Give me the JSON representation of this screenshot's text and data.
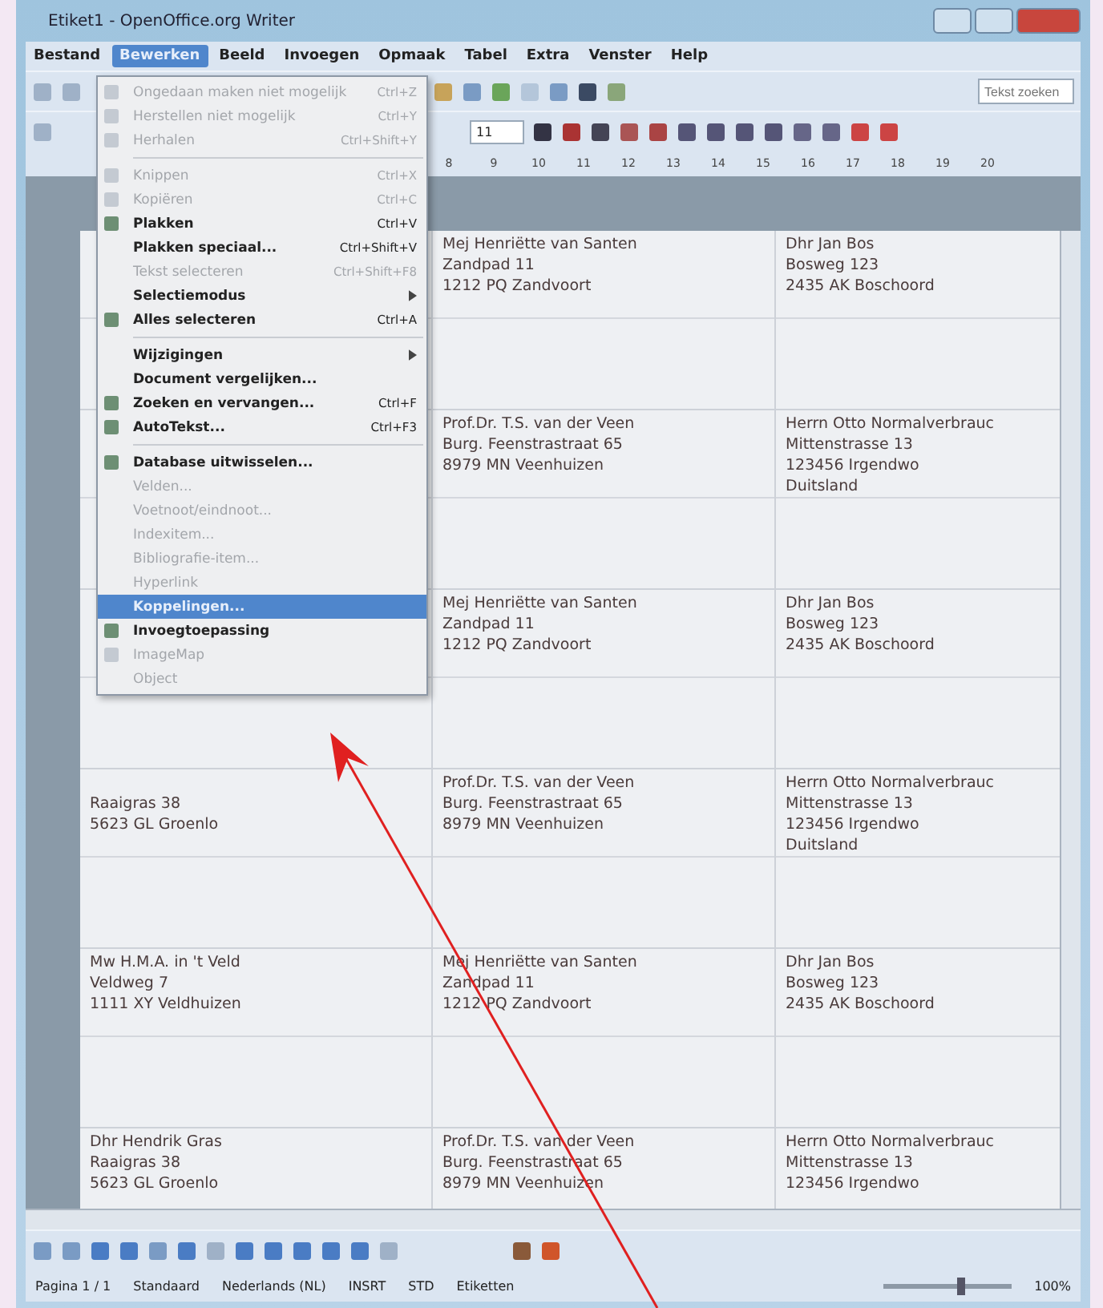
{
  "window": {
    "title": "Etiket1 - OpenOffice.org Writer"
  },
  "menubar": [
    {
      "label": "Bestand",
      "selected": false
    },
    {
      "label": "Bewerken",
      "selected": true
    },
    {
      "label": "Beeld",
      "selected": false
    },
    {
      "label": "Invoegen",
      "selected": false
    },
    {
      "label": "Opmaak",
      "selected": false
    },
    {
      "label": "Tabel",
      "selected": false
    },
    {
      "label": "Extra",
      "selected": false
    },
    {
      "label": "Venster",
      "selected": false
    },
    {
      "label": "Help",
      "selected": false
    }
  ],
  "toolbar": {
    "search": {
      "placeholder": "Tekst zoeken"
    },
    "font_size": "11"
  },
  "ruler": {
    "ticks": [
      "8",
      "9",
      "10",
      "11",
      "12",
      "13",
      "14",
      "15",
      "16",
      "17",
      "18",
      "19",
      "20"
    ]
  },
  "edit_menu": {
    "items": [
      {
        "kind": "item",
        "label": "Ongedaan maken niet mogelijk",
        "shortcut": "Ctrl+Z",
        "disabled": true,
        "selected": false,
        "submenu": false,
        "icon": true
      },
      {
        "kind": "item",
        "label": "Herstellen niet mogelijk",
        "shortcut": "Ctrl+Y",
        "disabled": true,
        "selected": false,
        "submenu": false,
        "icon": true
      },
      {
        "kind": "item",
        "label": "Herhalen",
        "shortcut": "Ctrl+Shift+Y",
        "disabled": true,
        "selected": false,
        "submenu": false,
        "icon": true
      },
      {
        "kind": "separator"
      },
      {
        "kind": "item",
        "label": "Knippen",
        "shortcut": "Ctrl+X",
        "disabled": true,
        "selected": false,
        "submenu": false,
        "icon": true
      },
      {
        "kind": "item",
        "label": "Kopiëren",
        "shortcut": "Ctrl+C",
        "disabled": true,
        "selected": false,
        "submenu": false,
        "icon": true
      },
      {
        "kind": "item",
        "label": "Plakken",
        "shortcut": "Ctrl+V",
        "disabled": false,
        "selected": false,
        "submenu": false,
        "icon": true
      },
      {
        "kind": "item",
        "label": "Plakken speciaal...",
        "shortcut": "Ctrl+Shift+V",
        "disabled": false,
        "selected": false,
        "submenu": false,
        "icon": false
      },
      {
        "kind": "item",
        "label": "Tekst selecteren",
        "shortcut": "Ctrl+Shift+F8",
        "disabled": true,
        "selected": false,
        "submenu": false,
        "icon": false
      },
      {
        "kind": "item",
        "label": "Selectiemodus",
        "disabled": false,
        "selected": false,
        "submenu": true,
        "icon": false
      },
      {
        "kind": "item",
        "label": "Alles selecteren",
        "shortcut": "Ctrl+A",
        "disabled": false,
        "selected": false,
        "submenu": false,
        "icon": true
      },
      {
        "kind": "separator"
      },
      {
        "kind": "item",
        "label": "Wijzigingen",
        "disabled": false,
        "selected": false,
        "submenu": true,
        "icon": false
      },
      {
        "kind": "item",
        "label": "Document vergelijken...",
        "disabled": false,
        "selected": false,
        "submenu": false,
        "icon": false
      },
      {
        "kind": "item",
        "label": "Zoeken en vervangen...",
        "shortcut": "Ctrl+F",
        "disabled": false,
        "selected": false,
        "submenu": false,
        "icon": true
      },
      {
        "kind": "item",
        "label": "AutoTekst...",
        "shortcut": "Ctrl+F3",
        "disabled": false,
        "selected": false,
        "submenu": false,
        "icon": true
      },
      {
        "kind": "separator"
      },
      {
        "kind": "item",
        "label": "Database uitwisselen...",
        "disabled": false,
        "selected": false,
        "submenu": false,
        "icon": true
      },
      {
        "kind": "item",
        "label": "Velden...",
        "disabled": true,
        "selected": false,
        "submenu": false,
        "icon": false
      },
      {
        "kind": "item",
        "label": "Voetnoot/eindnoot...",
        "disabled": true,
        "selected": false,
        "submenu": false,
        "icon": false
      },
      {
        "kind": "item",
        "label": "Indexitem...",
        "disabled": true,
        "selected": false,
        "submenu": false,
        "icon": false
      },
      {
        "kind": "item",
        "label": "Bibliografie-item...",
        "disabled": true,
        "selected": false,
        "submenu": false,
        "icon": false
      },
      {
        "kind": "item",
        "label": "Hyperlink",
        "disabled": true,
        "selected": false,
        "submenu": false,
        "icon": false
      },
      {
        "kind": "item",
        "label": "Koppelingen...",
        "disabled": false,
        "selected": true,
        "submenu": false,
        "icon": false
      },
      {
        "kind": "item",
        "label": "Invoegtoepassing",
        "disabled": false,
        "selected": false,
        "submenu": false,
        "icon": true
      },
      {
        "kind": "item",
        "label": "ImageMap",
        "disabled": true,
        "selected": false,
        "submenu": false,
        "icon": true
      },
      {
        "kind": "item",
        "label": "Object",
        "disabled": true,
        "selected": false,
        "submenu": false,
        "icon": false
      }
    ]
  },
  "labels": {
    "rows": [
      {
        "cells": [
          {},
          {
            "lines": [
              "Mej Henriëtte van Santen",
              "Zandpad 11",
              "1212 PQ Zandvoort"
            ]
          },
          {
            "lines": [
              "Dhr Jan  Bos",
              "Bosweg 123",
              "2435 AK Boschoord"
            ]
          }
        ]
      },
      {
        "cells": [
          {},
          {
            "lines": [
              "Prof.Dr. T.S. van der Veen",
              "Burg. Feenstrastraat 65",
              "8979 MN Veenhuizen"
            ]
          },
          {
            "lines": [
              "Herrn Otto  Normalverbrauc",
              "Mittenstrasse 13",
              "123456 Irgendwo",
              "Duitsland"
            ]
          }
        ]
      },
      {
        "cells": [
          {},
          {
            "lines": [
              "Mej Henriëtte van Santen",
              "Zandpad 11",
              "1212 PQ Zandvoort"
            ]
          },
          {
            "lines": [
              "Dhr Jan  Bos",
              "Bosweg 123",
              "2435 AK Boschoord"
            ]
          }
        ]
      },
      {
        "cells": [
          {
            "covered": true,
            "lines": [
              "Raaigras 38",
              "5623 GL Groenlo"
            ]
          },
          {
            "lines": [
              "Prof.Dr. T.S. van der Veen",
              "Burg. Feenstrastraat 65",
              "8979 MN Veenhuizen"
            ]
          },
          {
            "lines": [
              "Herrn Otto  Normalverbrauc",
              "Mittenstrasse 13",
              "123456 Irgendwo",
              "Duitsland"
            ]
          }
        ]
      },
      {
        "cells": [
          {
            "lines": [
              "Mw H.M.A. in 't Veld",
              "Veldweg 7",
              "1111 XY Veldhuizen"
            ]
          },
          {
            "lines": [
              "Mej Henriëtte van Santen",
              "Zandpad 11",
              "1212 PQ Zandvoort"
            ]
          },
          {
            "lines": [
              "Dhr Jan  Bos",
              "Bosweg 123",
              "2435 AK Boschoord"
            ]
          }
        ]
      },
      {
        "cells": [
          {
            "lines": [
              "Dhr Hendrik  Gras",
              "Raaigras 38",
              "5623 GL Groenlo"
            ]
          },
          {
            "lines": [
              "Prof.Dr. T.S. van der Veen",
              "Burg. Feenstrastraat 65",
              "8979 MN Veenhuizen"
            ]
          },
          {
            "lines": [
              "Herrn Otto  Normalverbrauc",
              "Mittenstrasse 13",
              "123456 Irgendwo"
            ]
          }
        ]
      }
    ]
  },
  "status_bar": {
    "page": "Pagina 1 / 1",
    "style": "Standaard",
    "language": "Nederlands (NL)",
    "mode": "INSRT",
    "selection_mode": "STD",
    "section": "Etiketten",
    "zoom_slider": {
      "level": 0.6
    },
    "zoom": "100%"
  }
}
